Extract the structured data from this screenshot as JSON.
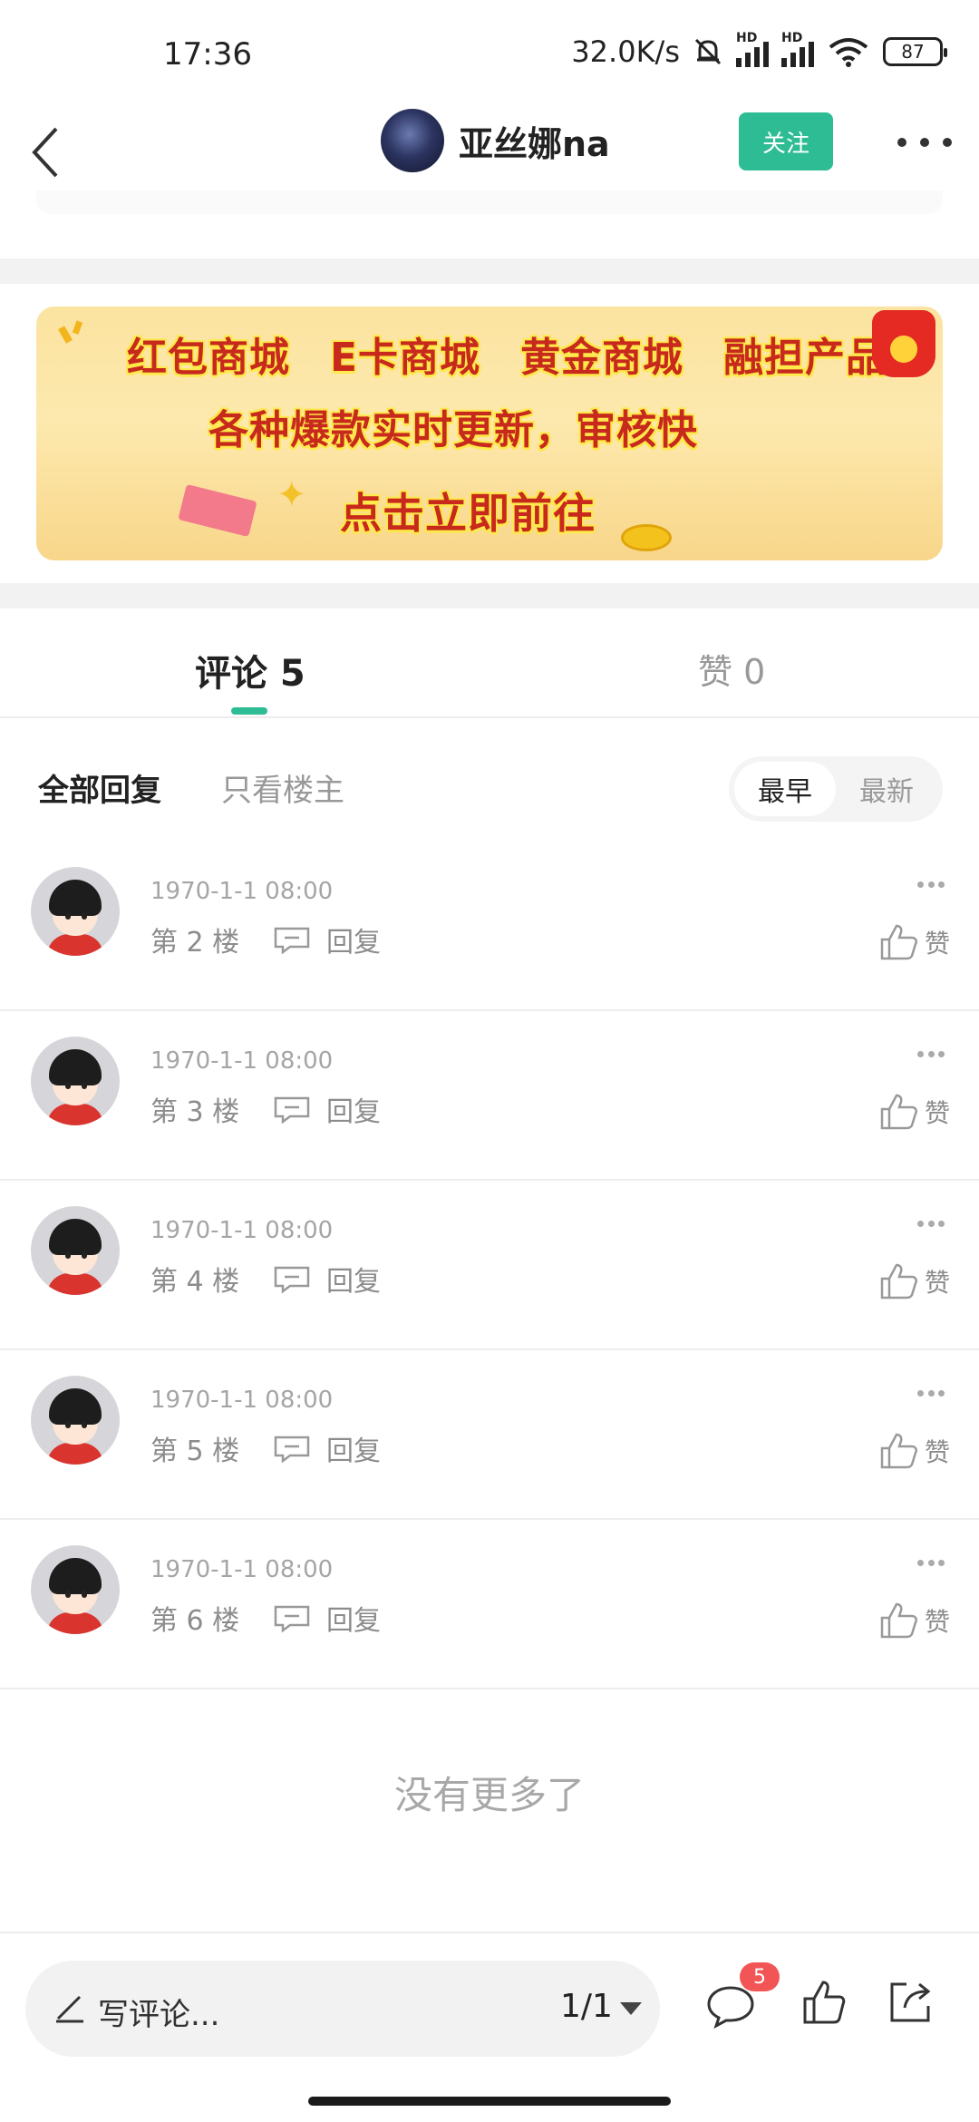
{
  "status_bar": {
    "time": "17:36",
    "net_speed": "32.0K/s",
    "battery": "87",
    "icons": [
      "mute-icon",
      "signal-icon",
      "signal-icon",
      "wifi-icon",
      "battery-icon"
    ]
  },
  "nav": {
    "username": "亚丝娜na",
    "follow_label": "关注",
    "icons": [
      "back-icon",
      "more-icon"
    ]
  },
  "banner": {
    "row1": [
      "红包商城",
      "E卡商城",
      "黄金商城",
      "融担产品"
    ],
    "row2": "各种爆款实时更新，审核快",
    "cta": "点击立即前往"
  },
  "tabs": {
    "comments": "评论 5",
    "likes": "赞 0"
  },
  "filter": {
    "all": "全部回复",
    "owner_only": "只看楼主",
    "sort_early": "最早",
    "sort_late": "最新"
  },
  "comments": [
    {
      "time": "1970-1-1 08:00",
      "floor": "第 2 楼",
      "reply": "回复",
      "like": "赞"
    },
    {
      "time": "1970-1-1 08:00",
      "floor": "第 3 楼",
      "reply": "回复",
      "like": "赞"
    },
    {
      "time": "1970-1-1 08:00",
      "floor": "第 4 楼",
      "reply": "回复",
      "like": "赞"
    },
    {
      "time": "1970-1-1 08:00",
      "floor": "第 5 楼",
      "reply": "回复",
      "like": "赞"
    },
    {
      "time": "1970-1-1 08:00",
      "floor": "第 6 楼",
      "reply": "回复",
      "like": "赞"
    }
  ],
  "no_more": "没有更多了",
  "bottom_bar": {
    "placeholder": "写评论...",
    "page": "1/1",
    "comment_badge": "5"
  },
  "colors": {
    "accent": "#2dbc93",
    "badge": "#f25555",
    "muted_text": "#999999"
  }
}
